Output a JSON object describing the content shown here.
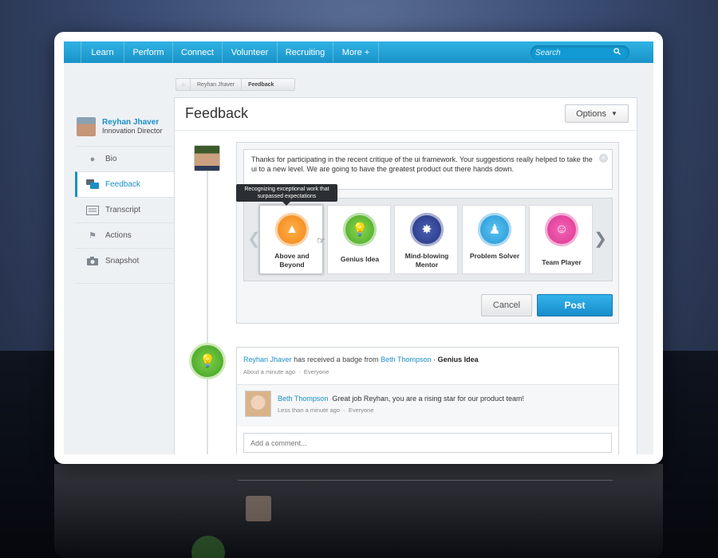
{
  "nav": {
    "items": [
      "Learn",
      "Perform",
      "Connect",
      "Volunteer",
      "Recruiting",
      "More +"
    ],
    "search_placeholder": "Search"
  },
  "breadcrumb": {
    "items": [
      "Reyhan Jhaver",
      "Feedback"
    ]
  },
  "profile": {
    "name": "Reyhan Jhaver",
    "title": "Innovation Director"
  },
  "sidebar": {
    "items": [
      {
        "label": "Bio",
        "icon": "person-icon"
      },
      {
        "label": "Feedback",
        "icon": "chat-bubbles-icon",
        "active": true
      },
      {
        "label": "Transcript",
        "icon": "transcript-icon"
      },
      {
        "label": "Actions",
        "icon": "flag-icon"
      },
      {
        "label": "Snapshot",
        "icon": "camera-icon"
      }
    ]
  },
  "main": {
    "title": "Feedback",
    "options_label": "Options"
  },
  "compose": {
    "message": "Thanks for participating in the recent critique of the ui framework. Your suggestions really helped to take the ui to a new level. We are going to have the greatest product out there hands down.",
    "tooltip": "Recognizing exceptional work that surpassed expectations",
    "badges": [
      {
        "label": "Above and Beyond",
        "color": "#f28a1c",
        "icon": "rocket-icon"
      },
      {
        "label": "Genius Idea",
        "color": "#4caf2a",
        "icon": "lightbulb-icon"
      },
      {
        "label": "Mind-blowing Mentor",
        "color": "#2c3e8f",
        "icon": "mentor-icon"
      },
      {
        "label": "Problem Solver",
        "color": "#2aa2e2",
        "icon": "puzzle-people-icon"
      },
      {
        "label": "Team Player",
        "color": "#e43c9c",
        "icon": "team-icon"
      }
    ],
    "cancel_label": "Cancel",
    "post_label": "Post"
  },
  "activity": {
    "recipient": "Reyhan Jhaver",
    "action": "has received a badge from",
    "giver": "Beth Thompson",
    "separator": "·",
    "badge": "Genius Idea",
    "time": "About a minute ago",
    "audience": "Everyone",
    "comment": {
      "author": "Beth Thompson",
      "text": "Great job Reyhan, you are a rising star for our product team!",
      "time": "Less than a minute ago",
      "audience": "Everyone"
    },
    "add_comment_placeholder": "Add a comment..."
  }
}
